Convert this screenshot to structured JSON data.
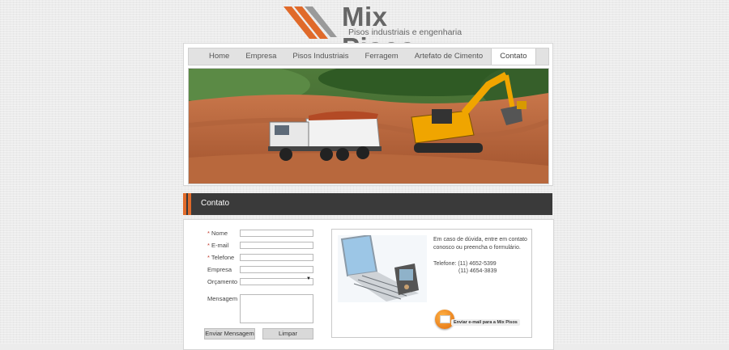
{
  "logo": {
    "title": "Mix Pisos",
    "subtitle": "Pisos industriais e engenharia",
    "brand_color": "#e06a2a"
  },
  "nav": {
    "items": [
      {
        "label": "Home"
      },
      {
        "label": "Empresa"
      },
      {
        "label": "Pisos Industriais"
      },
      {
        "label": "Ferragem"
      },
      {
        "label": "Artefato de Cimento"
      },
      {
        "label": "Contato"
      }
    ],
    "active": "Contato"
  },
  "section": {
    "title": "Contato"
  },
  "form": {
    "fields": {
      "nome": "Nome",
      "email": "E-mail",
      "telefone": "Telefone",
      "empresa": "Empresa",
      "orcamento": "Orçamento",
      "mensagem": "Mensagem"
    },
    "required_mark": "*",
    "send_label": "Enviar Mensagem",
    "clear_label": "Limpar"
  },
  "info": {
    "text": "Em caso de dúvida, entre em contato conosco ou preencha o formulário.",
    "phone_label": "Telefone: (11) 4652-5399",
    "phone_2": "(11) 4654-3839",
    "email_button": "Enviar e-mail para a Mix Pisos"
  }
}
